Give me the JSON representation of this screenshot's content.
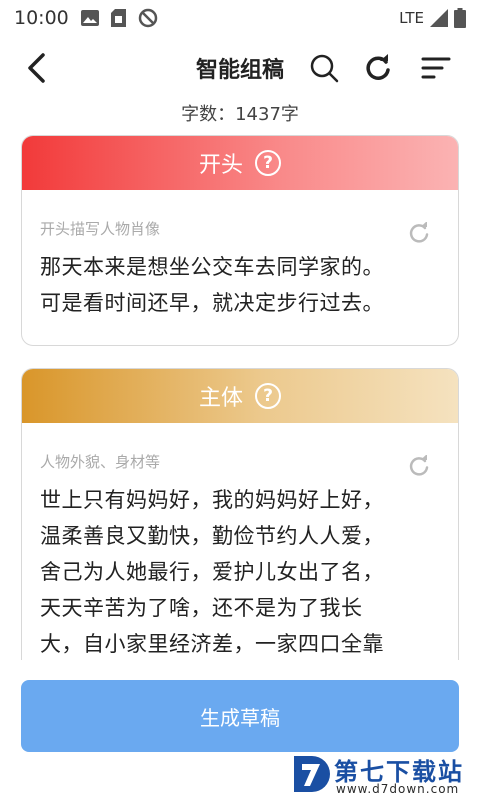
{
  "status_bar": {
    "time": "10:00",
    "network": "LTE",
    "icons": [
      "image-icon",
      "sim-card-icon",
      "do-not-disturb-icon",
      "signal-icon",
      "battery-icon"
    ]
  },
  "toolbar": {
    "title": "智能组稿",
    "back_icon": "chevron-left-icon",
    "search_icon": "search-icon",
    "refresh_icon": "refresh-icon",
    "sort_icon": "sort-lines-icon"
  },
  "word_count": "字数：1437字",
  "sections": [
    {
      "header": "开头",
      "header_color_start": "#f23a3a",
      "hint": "开头描写人物肖像",
      "lines": [
        "那天本来是想坐公交车去同学家的。",
        "可是看时间还早，就决定步行过去。"
      ]
    },
    {
      "header": "主体",
      "header_color_start": "#d9962a",
      "hint": "人物外貌、身材等",
      "lines": [
        "世上只有妈妈好，我的妈妈好上好，",
        "温柔善良又勤快，勤俭节约人人爱，",
        "舍己为人她最行，爱护儿女出了名，",
        "天天辛苦为了啥，还不是为了我长",
        "大，自小家里经济差，一家四口全靠"
      ]
    }
  ],
  "help_glyph": "?",
  "generate_button": "生成草稿",
  "accent_color": "#6aa9f0",
  "watermark": {
    "name": "第七下载站",
    "url": "www.d7down.com"
  }
}
